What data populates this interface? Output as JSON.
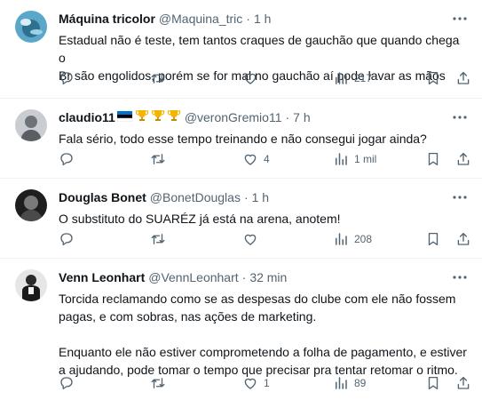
{
  "tweets": [
    {
      "name": "Máquina tricolor",
      "handle": "@Maquina_tric",
      "dot": "·",
      "time": "1 h",
      "lines": [
        "Estadual não é teste, tem tantos craques de gauchão que quando chega o",
        "Br são engolidos, porém se for mal no gauchão aí pode lavar as mãos"
      ],
      "extra_lines": [],
      "like_count": "",
      "views_count": "217",
      "avatar_color": "#4a8fb0"
    },
    {
      "name": "claudio11",
      "badges": [
        "🇪🇪",
        "🏆",
        "🏆",
        "🏆"
      ],
      "handle": "@veronGremio11",
      "dot": "·",
      "time": "7 h",
      "lines": [
        "Fala sério, todo esse tempo treinando e não consegui jogar ainda?"
      ],
      "extra_lines": [],
      "like_count": "4",
      "views_count": "1 mil",
      "avatar_color": "#8a8f94"
    },
    {
      "name": "Douglas Bonet",
      "handle": "@BonetDouglas",
      "dot": "·",
      "time": "1 h",
      "lines": [
        "O substituto do SUARÉZ já está na arena, anotem!"
      ],
      "extra_lines": [],
      "like_count": "",
      "views_count": "208",
      "avatar_color": "#3a3a3a"
    },
    {
      "name": "Venn Leonhart",
      "handle": "@VennLeonhart",
      "dot": "·",
      "time": "32 min",
      "lines": [
        "Torcida reclamando como se as despesas do clube com ele não fossem",
        "pagas, e com sobras, nas ações de marketing."
      ],
      "extra_lines": [
        "Enquanto ele não estiver comprometendo a folha de pagamento, e estiver",
        "a ajudando, pode tomar o tempo que precisar pra tentar retomar o ritmo."
      ],
      "like_count": "1",
      "views_count": "89",
      "avatar_color": "#2c2c2c"
    }
  ],
  "colors": {
    "text_primary": "#0f1419",
    "text_secondary": "#536471",
    "divider": "#eff3f4"
  },
  "icons": [
    "more-icon",
    "reply-icon",
    "repost-icon",
    "like-icon",
    "views-icon",
    "bookmark-icon",
    "share-icon"
  ]
}
